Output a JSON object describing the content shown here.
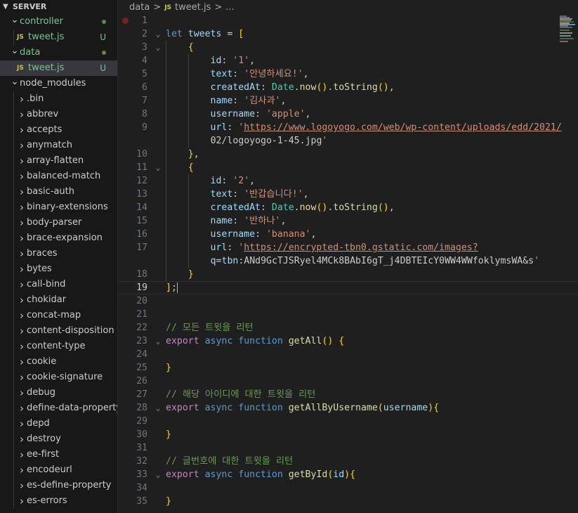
{
  "explorer": {
    "title": "SERVER",
    "items": [
      {
        "label": "controller",
        "kind": "folder-open",
        "level": 1,
        "status": "dot"
      },
      {
        "label": "tweet.js",
        "kind": "js",
        "level": 2,
        "status": "U"
      },
      {
        "label": "data",
        "kind": "folder-open",
        "level": 1,
        "status": "dot"
      },
      {
        "label": "tweet.js",
        "kind": "js",
        "level": 2,
        "status": "U",
        "selected": true
      },
      {
        "label": "node_modules",
        "kind": "folder-open",
        "level": 1
      },
      {
        "label": ".bin",
        "kind": "folder",
        "level": 2
      },
      {
        "label": "abbrev",
        "kind": "folder",
        "level": 2
      },
      {
        "label": "accepts",
        "kind": "folder",
        "level": 2
      },
      {
        "label": "anymatch",
        "kind": "folder",
        "level": 2
      },
      {
        "label": "array-flatten",
        "kind": "folder",
        "level": 2
      },
      {
        "label": "balanced-match",
        "kind": "folder",
        "level": 2
      },
      {
        "label": "basic-auth",
        "kind": "folder",
        "level": 2
      },
      {
        "label": "binary-extensions",
        "kind": "folder",
        "level": 2
      },
      {
        "label": "body-parser",
        "kind": "folder",
        "level": 2
      },
      {
        "label": "brace-expansion",
        "kind": "folder",
        "level": 2
      },
      {
        "label": "braces",
        "kind": "folder",
        "level": 2
      },
      {
        "label": "bytes",
        "kind": "folder",
        "level": 2
      },
      {
        "label": "call-bind",
        "kind": "folder",
        "level": 2
      },
      {
        "label": "chokidar",
        "kind": "folder",
        "level": 2
      },
      {
        "label": "concat-map",
        "kind": "folder",
        "level": 2
      },
      {
        "label": "content-disposition",
        "kind": "folder",
        "level": 2
      },
      {
        "label": "content-type",
        "kind": "folder",
        "level": 2
      },
      {
        "label": "cookie",
        "kind": "folder",
        "level": 2
      },
      {
        "label": "cookie-signature",
        "kind": "folder",
        "level": 2
      },
      {
        "label": "debug",
        "kind": "folder",
        "level": 2
      },
      {
        "label": "define-data-property",
        "kind": "folder",
        "level": 2
      },
      {
        "label": "depd",
        "kind": "folder",
        "level": 2
      },
      {
        "label": "destroy",
        "kind": "folder",
        "level": 2
      },
      {
        "label": "ee-first",
        "kind": "folder",
        "level": 2
      },
      {
        "label": "encodeurl",
        "kind": "folder",
        "level": 2
      },
      {
        "label": "es-define-property",
        "kind": "folder",
        "level": 2
      },
      {
        "label": "es-errors",
        "kind": "folder",
        "level": 2
      }
    ]
  },
  "breadcrumb": {
    "folder": "data",
    "sep": ">",
    "file": "tweet.js",
    "more": "..."
  },
  "code": [
    {
      "n": "1",
      "t": ""
    },
    {
      "n": "2",
      "t": "let tweets = ["
    },
    {
      "n": "3",
      "t": "    {"
    },
    {
      "n": "4",
      "t": "        id: '1',"
    },
    {
      "n": "5",
      "t": "        text: '안녕하세요!',"
    },
    {
      "n": "6",
      "t": "        createdAt: Date.now().toString(),"
    },
    {
      "n": "7",
      "t": "        name: '김사과',"
    },
    {
      "n": "8",
      "t": "        username: 'apple',"
    },
    {
      "n": "9",
      "t": "        url: 'https://www.logoyogo.com/web/wp-content/uploads/edd/2021/"
    },
    {
      "n": "",
      "t": "02/logoyogo-1-45.jpg'"
    },
    {
      "n": "10",
      "t": "    },"
    },
    {
      "n": "11",
      "t": "    {"
    },
    {
      "n": "12",
      "t": "        id: '2',"
    },
    {
      "n": "13",
      "t": "        text: '반갑습니다!',"
    },
    {
      "n": "14",
      "t": "        createdAt: Date.now().toString(),"
    },
    {
      "n": "15",
      "t": "        name: '반하나',"
    },
    {
      "n": "16",
      "t": "        username: 'banana',"
    },
    {
      "n": "17",
      "t": "        url: 'https://encrypted-tbn0.gstatic.com/images?"
    },
    {
      "n": "",
      "t": "q=tbn:ANd9GcTJSRyel4MCk8BAbI6gT_j4DBTEIcY0WW4WWfoklymsWA&s'"
    },
    {
      "n": "18",
      "t": "    }"
    },
    {
      "n": "19",
      "t": "];"
    },
    {
      "n": "20",
      "t": ""
    },
    {
      "n": "21",
      "t": ""
    },
    {
      "n": "22",
      "t": "// 모든 트윗을 리턴"
    },
    {
      "n": "23",
      "t": "export async function getAll() {"
    },
    {
      "n": "24",
      "t": ""
    },
    {
      "n": "25",
      "t": "}"
    },
    {
      "n": "26",
      "t": ""
    },
    {
      "n": "27",
      "t": "// 해당 아이디에 대한 트윗을 리턴"
    },
    {
      "n": "28",
      "t": "export async function getAllByUsername(username){"
    },
    {
      "n": "29",
      "t": ""
    },
    {
      "n": "30",
      "t": "}"
    },
    {
      "n": "31",
      "t": ""
    },
    {
      "n": "32",
      "t": "// 글번호에 대한 트윗을 리턴"
    },
    {
      "n": "33",
      "t": "export async function getById(id){"
    },
    {
      "n": "34",
      "t": ""
    },
    {
      "n": "35",
      "t": "}"
    }
  ],
  "colors": {
    "accent": "#37373d",
    "git_untracked": "#73c991",
    "keyword": "#569cd6",
    "string": "#ce9178",
    "function": "#dcdcaa",
    "comment": "#6a9955"
  }
}
